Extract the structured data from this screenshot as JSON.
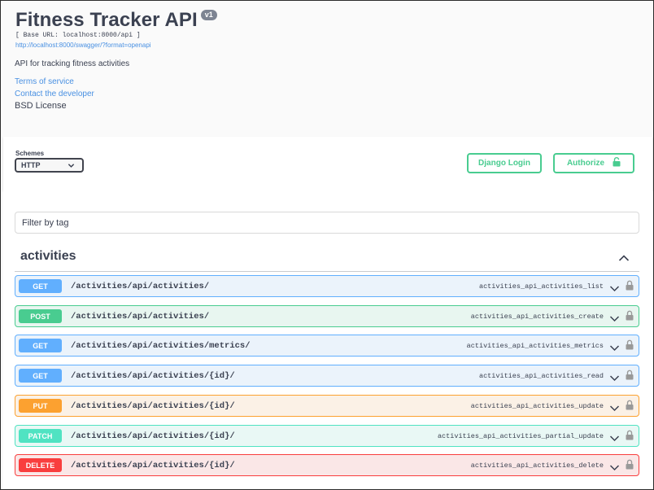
{
  "info": {
    "title": "Fitness Tracker API",
    "version": "v1",
    "base_url": "[ Base URL: localhost:8000/api ]",
    "spec_link": "http://localhost:8000/swagger/?format=openapi",
    "description": "API for tracking fitness activities",
    "terms": "Terms of service",
    "contact": "Contact the developer",
    "license": "BSD License"
  },
  "schemes": {
    "label": "Schemes",
    "selected": "HTTP"
  },
  "buttons": {
    "django_login": "Django Login",
    "authorize": "Authorize"
  },
  "filter": {
    "placeholder": "Filter by tag"
  },
  "tag": {
    "name": "activities"
  },
  "operations": [
    {
      "method": "GET",
      "path": "/activities/api/activities/",
      "operation_id": "activities_api_activities_list"
    },
    {
      "method": "POST",
      "path": "/activities/api/activities/",
      "operation_id": "activities_api_activities_create"
    },
    {
      "method": "GET",
      "path": "/activities/api/activities/metrics/",
      "operation_id": "activities_api_activities_metrics"
    },
    {
      "method": "GET",
      "path": "/activities/api/activities/{id}/",
      "operation_id": "activities_api_activities_read"
    },
    {
      "method": "PUT",
      "path": "/activities/api/activities/{id}/",
      "operation_id": "activities_api_activities_update"
    },
    {
      "method": "PATCH",
      "path": "/activities/api/activities/{id}/",
      "operation_id": "activities_api_activities_partial_update"
    },
    {
      "method": "DELETE",
      "path": "/activities/api/activities/{id}/",
      "operation_id": "activities_api_activities_delete"
    }
  ],
  "colors": {
    "get": "#61affe",
    "post": "#49cc90",
    "put": "#fca130",
    "patch": "#50e3c2",
    "delete": "#f93e3e",
    "link": "#4990e2"
  }
}
